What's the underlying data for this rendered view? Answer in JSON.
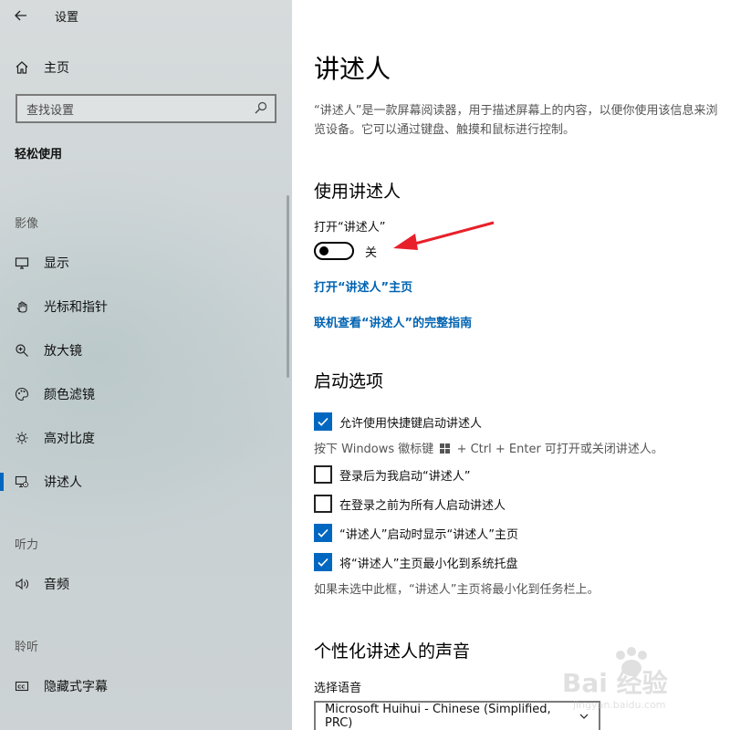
{
  "window": {
    "title": "设置"
  },
  "sidebar": {
    "home_label": "主页",
    "search_placeholder": "查找设置",
    "section": "轻松使用",
    "groups": {
      "vision": "影像",
      "hearing": "听力",
      "interaction": "聆听"
    },
    "items": [
      {
        "label": "显示",
        "icon": "monitor-icon"
      },
      {
        "label": "光标和指针",
        "icon": "pointer-icon"
      },
      {
        "label": "放大镜",
        "icon": "magnifier-icon"
      },
      {
        "label": "颜色滤镜",
        "icon": "palette-icon"
      },
      {
        "label": "高对比度",
        "icon": "contrast-icon"
      },
      {
        "label": "讲述人",
        "icon": "narrator-icon",
        "active": true
      },
      {
        "label": "音频",
        "icon": "speaker-icon"
      },
      {
        "label": "隐藏式字幕",
        "icon": "caption-icon"
      }
    ]
  },
  "main": {
    "title": "讲述人",
    "description": "“讲述人”是一款屏幕阅读器，用于描述屏幕上的内容，以便你使用该信息来浏览设备。它可以通过键盘、触摸和鼠标进行控制。",
    "use_section": {
      "heading": "使用讲述人",
      "toggle_label": "打开“讲述人”",
      "toggle_state": "关",
      "toggle_on": false,
      "link_home": "打开“讲述人”主页",
      "link_guide": "联机查看“讲述人”的完整指南"
    },
    "startup_section": {
      "heading": "启动选项",
      "options": [
        {
          "label": "允许使用快捷键启动讲述人",
          "checked": true
        },
        {
          "label": "登录后为我启动“讲述人”",
          "checked": false
        },
        {
          "label": "在登录之前为所有人启动讲述人",
          "checked": false
        },
        {
          "label": "“讲述人”启动时显示“讲述人”主页",
          "checked": true
        },
        {
          "label": "将“讲述人”主页最小化到系统托盘",
          "checked": true
        }
      ],
      "shortcut_hint_pre": "按下 Windows 徽标键",
      "shortcut_hint_post": "+ Ctrl + Enter 可打开或关闭讲述人。",
      "tray_hint": "如果未选中此框，“讲述人”主页将最小化到任务栏上。"
    },
    "voice_section": {
      "heading": "个性化讲述人的声音",
      "select_label": "选择语音",
      "select_value": "Microsoft Huihui - Chinese (Simplified, PRC)"
    }
  },
  "annotation": {
    "arrow_color": "#e8202a"
  },
  "watermark": {
    "text": "Bai 经验",
    "sub": "jingyan.baidu.com"
  },
  "colors": {
    "accent": "#0067c0",
    "link": "#0063b1"
  }
}
